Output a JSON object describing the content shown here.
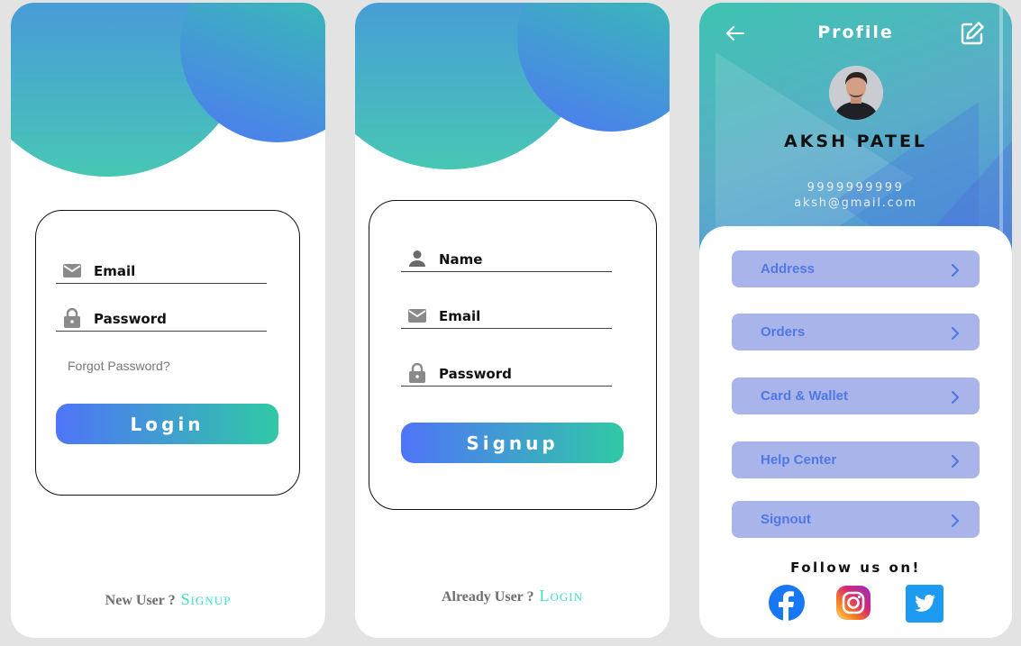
{
  "login": {
    "email_label": "Email",
    "password_label": "Password",
    "forgot_text": "Forgot Password?",
    "button_label": "Login",
    "footer_prefix": "New User ?",
    "footer_link": "Signup"
  },
  "signup": {
    "name_label": "Name",
    "email_label": "Email",
    "password_label": "Password",
    "button_label": "Signup",
    "footer_prefix": "Already User ?",
    "footer_link": "Login"
  },
  "profile": {
    "title": "Profile",
    "name": "AKSH PATEL",
    "phone": "9999999999",
    "email": "aksh@gmail.com",
    "menu": [
      {
        "label": "Address"
      },
      {
        "label": "Orders"
      },
      {
        "label": "Card & Wallet"
      },
      {
        "label": "Help Center"
      },
      {
        "label": "Signout"
      }
    ],
    "follow_text": "Follow us on!"
  },
  "icons": [
    "email-icon",
    "lock-icon",
    "person-icon",
    "back-arrow-icon",
    "edit-icon",
    "chevron-right-icon",
    "facebook-icon",
    "instagram-icon",
    "twitter-icon"
  ],
  "colors": {
    "accent_blue": "#4f74f8",
    "accent_teal": "#30c9a6",
    "link": "#3ce0c8",
    "menu_bg": "#a9b5ea",
    "menu_text": "#4f78e6"
  }
}
